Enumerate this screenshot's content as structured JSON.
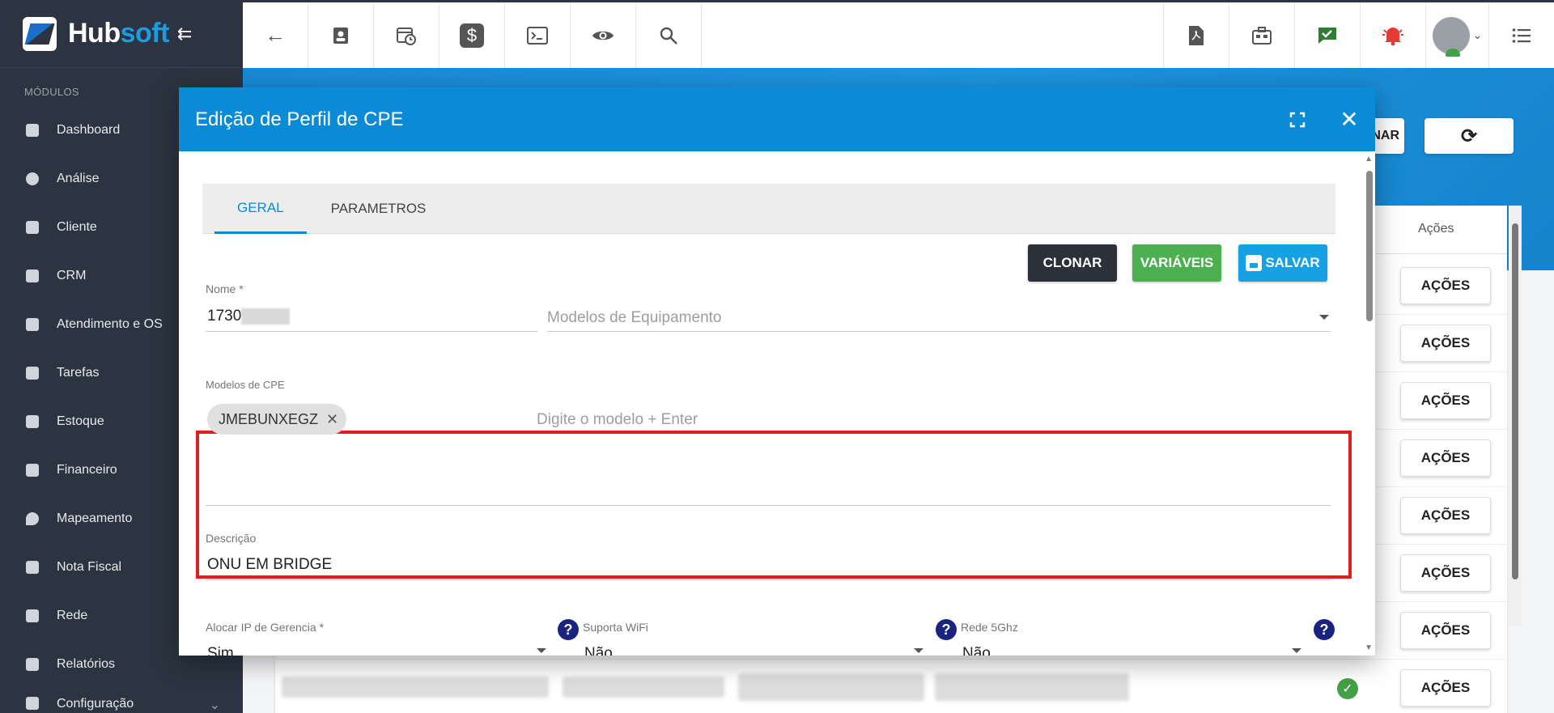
{
  "sidebar": {
    "brand_hub": "Hub",
    "brand_soft": "soft",
    "modules_title": "MÓDULOS",
    "items": [
      {
        "label": "Dashboard"
      },
      {
        "label": "Análise"
      },
      {
        "label": "Cliente"
      },
      {
        "label": "CRM"
      },
      {
        "label": "Atendimento e OS"
      },
      {
        "label": "Tarefas"
      },
      {
        "label": "Estoque"
      },
      {
        "label": "Financeiro"
      },
      {
        "label": "Mapeamento"
      },
      {
        "label": "Nota Fiscal"
      },
      {
        "label": "Rede"
      },
      {
        "label": "Relatórios"
      },
      {
        "label": "Configuração"
      }
    ]
  },
  "topbar": {
    "left_icons": [
      "back-arrow-icon",
      "contact-card-icon",
      "calendar-clock-icon",
      "dollar-icon",
      "terminal-icon",
      "eye-icon",
      "search-icon"
    ],
    "right_icons": [
      "pdf-icon",
      "building-icon",
      "chat-check-icon",
      "alarm-bell-icon",
      "avatar",
      "list-menu-icon"
    ]
  },
  "background": {
    "band_button_partial": "NAR",
    "table_header_acoes": "Ações",
    "row_action_label": "AÇÕES",
    "row_count": 8
  },
  "modal": {
    "title": "Edição de Perfil de CPE",
    "tabs": [
      {
        "label": "GERAL",
        "active": true
      },
      {
        "label": "PARAMETROS",
        "active": false
      }
    ],
    "buttons": {
      "clonar": "CLONAR",
      "variaveis": "VARIÁVEIS",
      "salvar": "SALVAR"
    },
    "fields": {
      "nome_label": "Nome *",
      "nome_value": "1730",
      "modelos_equipamento_placeholder": "Modelos de Equipamento",
      "modelos_cpe_label": "Modelos de CPE",
      "modelos_cpe_chip": "JMEBUNXEGZ",
      "modelos_cpe_placeholder": "Digite o modelo + Enter",
      "descricao_label": "Descrição",
      "descricao_value": "ONU EM BRIDGE",
      "alocar_ip_label": "Alocar IP de Gerencia *",
      "alocar_ip_value": "Sim",
      "suporta_wifi_label": "Suporta WiFi",
      "suporta_wifi_value": "Não",
      "rede_5ghz_label": "Rede 5Ghz",
      "rede_5ghz_value": "Não"
    },
    "help_symbol": "?"
  },
  "colors": {
    "sidebar_bg": "#2b3440",
    "modal_header": "#0b8ad6",
    "accent_blue": "#16a1e3",
    "success_green": "#4caf50",
    "dark_button": "#2c3039",
    "highlight_red": "#e31c1c",
    "help_navy": "#1a237e"
  }
}
